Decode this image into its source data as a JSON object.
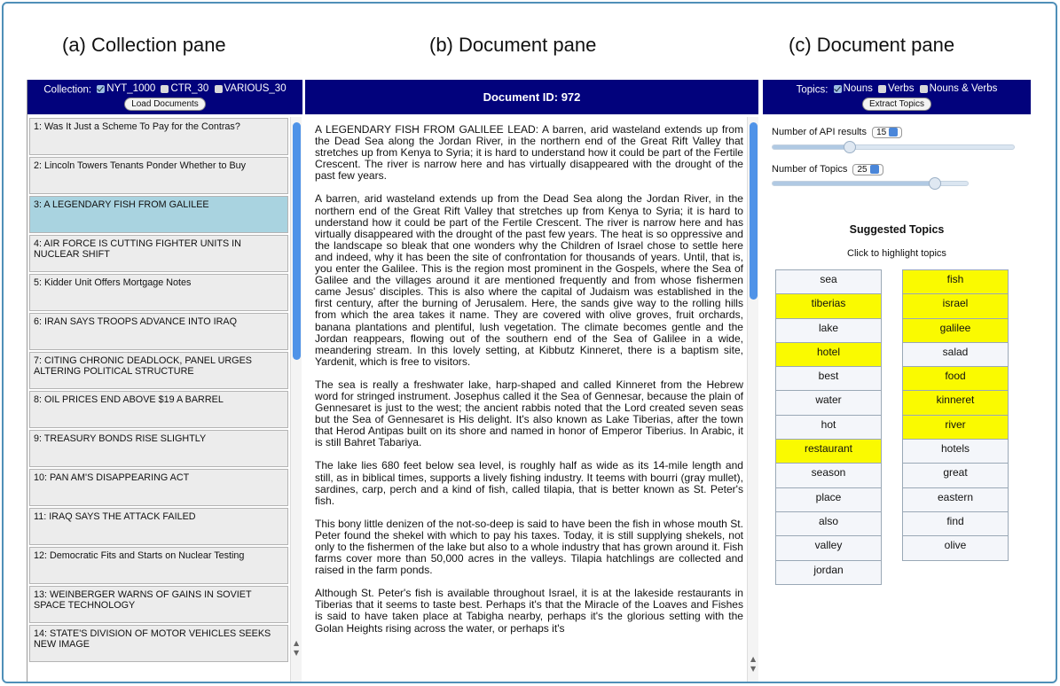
{
  "captions": {
    "a": "(a) Collection pane",
    "b": "(b) Document pane",
    "c": "(c) Document pane"
  },
  "collection_pane": {
    "label": "Collection:",
    "options": [
      {
        "label": "NYT_1000",
        "checked": true
      },
      {
        "label": "CTR_30",
        "checked": false
      },
      {
        "label": "VARIOUS_30",
        "checked": false
      }
    ],
    "load_button": "Load Documents",
    "documents": [
      "1: Was It Just a Scheme To Pay for the Contras?",
      "2: Lincoln Towers Tenants Ponder Whether to Buy",
      "3: A LEGENDARY FISH FROM GALILEE",
      "4: AIR FORCE IS CUTTING FIGHTER UNITS IN NUCLEAR SHIFT",
      "5: Kidder Unit Offers Mortgage Notes",
      "6: IRAN SAYS TROOPS ADVANCE INTO IRAQ",
      "7: CITING CHRONIC DEADLOCK, PANEL URGES ALTERING POLITICAL STRUCTURE",
      "8: OIL PRICES END ABOVE $19 A BARREL",
      "9: TREASURY BONDS RISE SLIGHTLY",
      "10: PAN AM'S DISAPPEARING ACT",
      "11: IRAQ SAYS THE ATTACK FAILED",
      "12: Democratic Fits and Starts on Nuclear Testing",
      "13: WEINBERGER WARNS OF GAINS IN SOVIET SPACE TECHNOLOGY",
      "14: STATE'S DIVISION OF MOTOR VEHICLES SEEKS NEW IMAGE"
    ],
    "selected_index": 2
  },
  "document_pane": {
    "title": "Document ID: 972",
    "paragraphs": [
      "A LEGENDARY FISH FROM GALILEE LEAD: A barren, arid wasteland extends up from the Dead Sea along the Jordan River, in the northern end of the Great Rift Valley that stretches up from Kenya to Syria; it is hard to understand how it could be part of the Fertile Crescent. The river is narrow here and has virtually disappeared with the drought of the past few years.",
      "A barren, arid wasteland extends up from the Dead Sea along the Jordan River, in the northern end of the Great Rift Valley that stretches up from Kenya to Syria; it is hard to understand how it could be part of the Fertile Crescent. The river is narrow here and has virtually disappeared with the drought of the past few years. The heat is so oppressive and the landscape so bleak that one wonders why the Children of Israel chose to settle here and indeed, why it has been the site of confrontation for thousands of years. Until, that is, you enter the Galilee. This is the region most prominent in the Gospels, where the Sea of Galilee and the villages around it are mentioned frequently and from whose fishermen came Jesus' disciples. This is also where the capital of Judaism was established in the first century, after the burning of Jerusalem. Here, the sands give way to the rolling hills from which the area takes it name. They are covered with olive groves, fruit orchards, banana plantations and plentiful, lush vegetation. The climate becomes gentle and the Jordan reappears, flowing out of the southern end of the Sea of Galilee in a wide, meandering stream. In this lovely setting, at Kibbutz Kinneret, there is a baptism site, Yardenit, which is free to visitors.",
      "The sea is really a freshwater lake, harp-shaped and called Kinneret from the Hebrew word for stringed instrument. Josephus called it the Sea of Gennesar, because the plain of Gennesaret is just to the west; the ancient rabbis noted that the Lord created seven seas but the Sea of Gennesaret is His delight. It's also known as Lake Tiberias, after the town that Herod Antipas built on its shore and named in honor of Emperor Tiberius. In Arabic, it is still Bahret Tabariya.",
      "The lake lies 680 feet below sea level, is roughly half as wide as its 14-mile length and still, as in biblical times, supports a lively fishing industry. It teems with bourri (gray mullet), sardines, carp, perch and a kind of fish, called tilapia, that is better known as St. Peter's fish.",
      "This bony little denizen of the not-so-deep is said to have been the fish in whose mouth St. Peter found the shekel with which to pay his taxes. Today, it is still supplying shekels, not only to the fishermen of the lake but also to a whole industry that has grown around it. Fish farms cover more than 50,000 acres in the valleys. Tilapia hatchlings are collected and raised in the farm ponds.",
      "Although St. Peter's fish is available throughout Israel, it is at the lakeside restaurants in Tiberias that it seems to taste best. Perhaps it's that the Miracle of the Loaves and Fishes is said to have taken place at Tabigha nearby, perhaps it's the glorious setting with the Golan Heights rising across the water, or perhaps it's"
    ]
  },
  "topics_pane": {
    "label": "Topics:",
    "options": [
      {
        "label": "Nouns",
        "checked": true
      },
      {
        "label": "Verbs",
        "checked": false
      },
      {
        "label": "Nouns & Verbs",
        "checked": false
      }
    ],
    "extract_button": "Extract Topics",
    "api_results_label": "Number of API results",
    "api_results_value": "15",
    "api_results_level": 0.32,
    "num_topics_label": "Number of Topics",
    "num_topics_value": "25",
    "num_topics_level": 0.83,
    "suggested_title": "Suggested Topics",
    "hint": "Click to highlight topics",
    "left_topics": [
      {
        "label": "sea",
        "highlighted": false
      },
      {
        "label": "tiberias",
        "highlighted": true
      },
      {
        "label": "lake",
        "highlighted": false
      },
      {
        "label": "hotel",
        "highlighted": true
      },
      {
        "label": "best",
        "highlighted": false
      },
      {
        "label": "water",
        "highlighted": false
      },
      {
        "label": "hot",
        "highlighted": false
      },
      {
        "label": "restaurant",
        "highlighted": true
      },
      {
        "label": "season",
        "highlighted": false
      },
      {
        "label": "place",
        "highlighted": false
      },
      {
        "label": "also",
        "highlighted": false
      },
      {
        "label": "valley",
        "highlighted": false
      },
      {
        "label": "jordan",
        "highlighted": false
      }
    ],
    "right_topics": [
      {
        "label": "fish",
        "highlighted": true
      },
      {
        "label": "israel",
        "highlighted": true
      },
      {
        "label": "galilee",
        "highlighted": true
      },
      {
        "label": "salad",
        "highlighted": false
      },
      {
        "label": "food",
        "highlighted": true
      },
      {
        "label": "kinneret",
        "highlighted": true
      },
      {
        "label": "river",
        "highlighted": true
      },
      {
        "label": "hotels",
        "highlighted": false
      },
      {
        "label": "great",
        "highlighted": false
      },
      {
        "label": "eastern",
        "highlighted": false
      },
      {
        "label": "find",
        "highlighted": false
      },
      {
        "label": "olive",
        "highlighted": false
      }
    ]
  }
}
